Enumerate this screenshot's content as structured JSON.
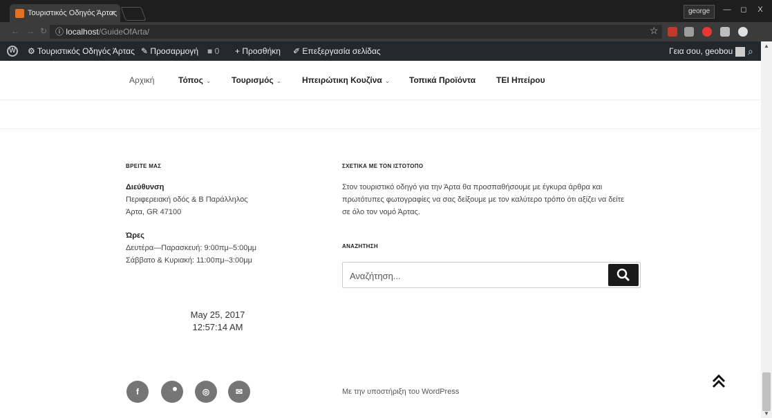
{
  "browser": {
    "tab_title": "Τουριστικός Οδηγός Άρτας",
    "tab_close": "×",
    "user": "george",
    "window_controls": [
      "—",
      "◻",
      "X"
    ],
    "url_host": "localhost",
    "url_path": "/GuideOfArta/",
    "info_icon": "ⓘ",
    "star_icon": "☆"
  },
  "admin_bar": {
    "site_name": "Τουριστικός Οδηγός Άρτας",
    "customize": "Προσαρμογή",
    "comments_count": "0",
    "add_new": "Προσθήκη",
    "edit_page": "Επεξεργασία σελίδας",
    "greeting": "Γεια σου, geobou"
  },
  "nav": {
    "items": [
      {
        "label": "Αρχική",
        "caret": ""
      },
      {
        "label": "Τόπος",
        "caret": "⌄"
      },
      {
        "label": "Τουρισμός",
        "caret": "⌄"
      },
      {
        "label": "Ηπειρώτικη Κουζίνα",
        "caret": "⌄"
      },
      {
        "label": "Τοπικά Προϊόντα",
        "caret": ""
      },
      {
        "label": "ΤΕΙ Ηπείρου",
        "caret": ""
      }
    ]
  },
  "footer": {
    "find_us": {
      "title": "ΒΡΕΙΤΕ ΜΑΣ",
      "address_label": "Διεύθυνση",
      "address_line1": "Περιφερειακή οδός & Β Παράλληλος",
      "address_line2": "Άρτα, GR 47100",
      "hours_label": "Ώρες",
      "hours_line1": "Δευτέρα—Παρασκευή: 9:00πμ–5:00μμ",
      "hours_line2": "Σάββατο & Κυριακή: 11:00πμ–3:00μμ"
    },
    "about": {
      "title": "ΣΧΕΤΙΚΑ ΜΕ ΤΟΝ ΙΣΤΟΤΟΠΟ",
      "line1": "Στον τουριστικό οδηγό για την Άρτα θα προσπαθήσουμε με έγκυρα άρθρα και",
      "line2": "πρωτότυπες φωτογραφίες να σας δείξουμε με τον καλύτερο τρόπο ότι αξίζει να δείτε",
      "line3": "σε όλο τον νομό Άρτας."
    },
    "search": {
      "title": "ΑΝΑΖΗΤΗΣΗ",
      "placeholder": "Αναζήτηση..."
    },
    "clock": {
      "date": "May 25, 2017",
      "time": "12:57:14 AM"
    },
    "social": [
      "f",
      "t",
      "◎",
      "✉"
    ],
    "powered_by": "Με την υποστήριξη του WordPress"
  },
  "colors": {
    "admin_bar": "#23282d",
    "chrome_dark": "#1e1e1e",
    "social_bg": "#757575",
    "search_btn": "#1a1a1a"
  }
}
